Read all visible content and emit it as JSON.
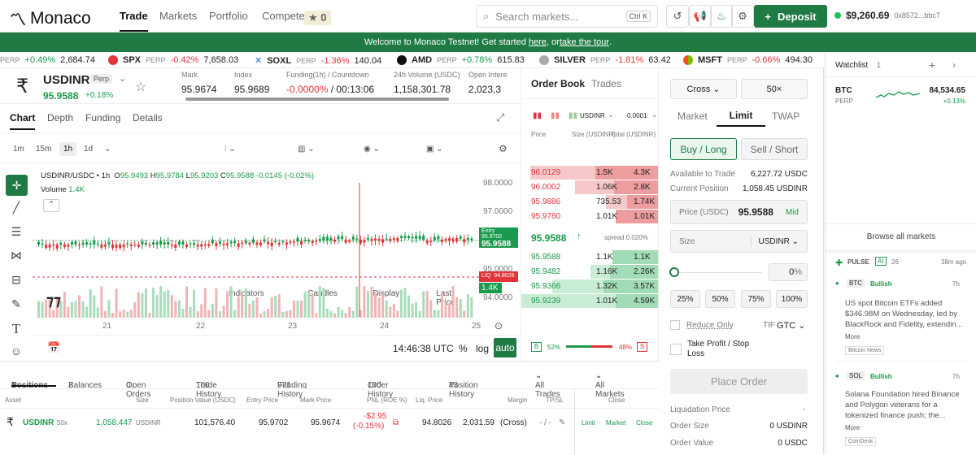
{
  "header": {
    "logo": "Monaco",
    "nav": [
      "Trade",
      "Markets",
      "Portfolio",
      "Compete"
    ],
    "compete_badge": "0",
    "search_placeholder": "Search markets...",
    "search_kbd": "Ctrl K",
    "deposit": "Deposit",
    "balance": "$9,260.69",
    "address": "0x8572...bbc7"
  },
  "banner": {
    "text1": "Welcome to Monaco Testnet! Get started ",
    "link1": "here",
    "text2": ", or ",
    "link2": "take the tour",
    "text3": "."
  },
  "ticker": [
    {
      "sym": "",
      "perp": "PERP",
      "chg": "+0.49%",
      "px": "2,684.74",
      "up": true
    },
    {
      "sym": "SPX",
      "perp": "PERP",
      "chg": "-0.42%",
      "px": "7,658.03",
      "up": false
    },
    {
      "sym": "SOXL",
      "perp": "PERP",
      "chg": "-1.36%",
      "px": "140.04",
      "up": false
    },
    {
      "sym": "AMD",
      "perp": "PERP",
      "chg": "+0.78%",
      "px": "615.83",
      "up": true
    },
    {
      "sym": "SILVER",
      "perp": "PERP",
      "chg": "-1.81%",
      "px": "63.42",
      "up": false
    },
    {
      "sym": "MSFT",
      "perp": "PERP",
      "chg": "-0.66%",
      "px": "494.30",
      "up": false
    }
  ],
  "market": {
    "symbol": "USDINR",
    "type": "Perp",
    "price": "95.9588",
    "change": "+0.18%",
    "mark_label": "Mark",
    "mark": "95.9674",
    "index_label": "Index",
    "index": "95.9689",
    "funding_label": "Funding(1h) / Countdown",
    "funding": "-0.0000%",
    "countdown": "/ 00:13:06",
    "vol_label": "24h Volume (USDC)",
    "vol": "1,158,301.78",
    "oi_label": "Open Intere",
    "oi": "2,023,3"
  },
  "chart_tabs": [
    "Chart",
    "Depth",
    "Funding",
    "Details"
  ],
  "timeframes": [
    "1m",
    "15m",
    "1h",
    "1d"
  ],
  "chart_tools": {
    "indicators": "Indicators",
    "candles": "Candles",
    "display": "Display",
    "last": "Last Price"
  },
  "chart_info": {
    "pair": "USDINR/USDC • 1h",
    "o": "95.9493",
    "h": "95.9784",
    "l": "95.9203",
    "c": "95.9588",
    "chg": "-0.0145 (-0.02%)",
    "volume_label": "Volume",
    "volume": "1.4K",
    "y_labels": [
      "98.0000",
      "97.0000",
      "95.0000",
      "94.0000"
    ],
    "x_labels": [
      "21",
      "22",
      "23",
      "24",
      "25"
    ],
    "entry_label": "Entry 95.9702",
    "entry_price": "95.9588",
    "liq_label": "LIQ",
    "liq_price": "94.8026",
    "vol_tag": "1.4K",
    "time": "14:46:38 UTC",
    "pct": "%",
    "log": "log",
    "auto": "auto"
  },
  "orderbook": {
    "tabs": [
      "Order Book",
      "Trades"
    ],
    "pair": "USDINR",
    "tick": "0.0001",
    "cols": [
      "Price",
      "Size (USDINR)",
      "Total (USDINR)"
    ],
    "asks": [
      [
        "96.0129",
        "1.5K",
        "4.3K"
      ],
      [
        "96.0002",
        "1.06K",
        "2.8K"
      ],
      [
        "95.9886",
        "735.53",
        "1.74K"
      ],
      [
        "95.9780",
        "1.01K",
        "1.01K"
      ]
    ],
    "mid": "95.9588",
    "spread": "spread  0.020%",
    "bids": [
      [
        "95.9588",
        "1.1K",
        "1.1K"
      ],
      [
        "95.9482",
        "1.16K",
        "2.26K"
      ],
      [
        "95.9366",
        "1.32K",
        "3.57K"
      ],
      [
        "95.9239",
        "1.01K",
        "4.59K"
      ]
    ],
    "b": "B",
    "bpct": "52%",
    "spct": "48%",
    "s": "S"
  },
  "trade": {
    "margin": "Cross",
    "leverage": "50×",
    "tabs": [
      "Market",
      "Limit",
      "TWAP"
    ],
    "buy": "Buy /  Long",
    "sell": "Sell /  Short",
    "avail_label": "Available to Trade",
    "avail": "6,227.72 USDC",
    "pos_label": "Current Position",
    "pos": "1,058.45 USDINR",
    "price_label": "Price (USDC)",
    "price": "95.9588",
    "mid": "Mid",
    "size_label": "Size",
    "size_unit": "USDINR",
    "pct_val": "0",
    "pct": [
      "25%",
      "50%",
      "75%",
      "100%"
    ],
    "reduce": "Reduce Only",
    "tif_label": "TIF",
    "tif": "GTC",
    "tpsl": "Take Profit / Stop Loss",
    "place": "Place Order",
    "liq_label": "Liquidation Price",
    "liq": "-",
    "osize_label": "Order Size",
    "osize": "0 USDINR",
    "oval_label": "Order Value",
    "oval": "0 USDC"
  },
  "watchlist": {
    "title": "Watchlist",
    "count": "1",
    "sym": "BTC",
    "perp": "PERP",
    "price": "84,534.65",
    "chg": "+0.13%",
    "browse": "Browse all markets",
    "pulse": "PULSE",
    "ai": "AI",
    "pulse_count": "26",
    "pulse_time": "38m ago",
    "news": [
      {
        "sym": "BTC",
        "tag": "Bullish",
        "time": "7h",
        "text": "US spot Bitcoin ETFs added $346.98M on Wednesday, led by BlackRock and Fidelity, extendin...",
        "more": "More",
        "src": "Bitcoin News"
      },
      {
        "sym": "SOL",
        "tag": "Bullish",
        "time": "7h",
        "text": "Solana Foundation hired Binance and Polygon veterans for a tokenized finance push; the...",
        "more": "More",
        "src": "CoinDesk"
      }
    ]
  },
  "bottom": {
    "tabs": [
      [
        "Positions",
        "1"
      ],
      [
        "Balances",
        "2"
      ],
      [
        "Open Orders",
        "0"
      ],
      [
        "Trade History",
        "100"
      ],
      [
        "Funding History",
        "971"
      ],
      [
        "Order History",
        "100"
      ],
      [
        "Position History",
        "43"
      ]
    ],
    "all_trades": "All Trades",
    "all_markets": "All Markets",
    "headers": [
      "Asset",
      "Size",
      "Position Value (USDC)",
      "Entry Price",
      "Mark Price",
      "PNL (ROE %)",
      "Liq. Price",
      "Margin",
      "TP/SL",
      "Close"
    ],
    "row": {
      "asset": "USDINR",
      "lev": "50x",
      "size": "1,058.447",
      "unit": "USDINR",
      "value": "101,576.40",
      "entry": "95.9702",
      "mark": "95.9674",
      "pnl": "-$2.95",
      "roe": "(-0.15%)",
      "liq": "94.8026",
      "margin": "2,031.59",
      "mtype": "(Cross)",
      "tpsl": "- / -",
      "limit": "Limit",
      "market": "Market",
      "close": "Close"
    }
  },
  "colors": {
    "green": "#1a9a4c",
    "red": "#e0353b",
    "brand": "#1f7a43"
  }
}
